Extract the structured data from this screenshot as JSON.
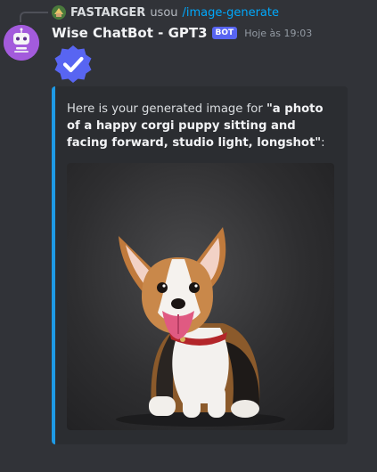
{
  "reply": {
    "user": "FASTARGER",
    "verb": "usou",
    "command": "/image-generate"
  },
  "message": {
    "author": "Wise ChatBot - GPT3",
    "bot_tag": "BOT",
    "timestamp": "Hoje às 19:03",
    "avatar_icon": "robot-icon"
  },
  "embed": {
    "text_prefix": "Here is your generated image for ",
    "prompt": "\"a photo of a happy corgi puppy sitting and facing forward, studio light, longshot\"",
    "text_suffix": ":",
    "accent_color": "#1e9ae6"
  },
  "colors": {
    "background": "#313338",
    "embed_background": "#2b2d31",
    "bot_tag": "#5865f2",
    "link": "#00a8fc",
    "verified_badge": "#5865f2"
  }
}
